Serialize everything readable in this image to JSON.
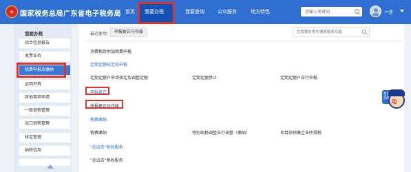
{
  "header": {
    "site_title": "国家税务总局广东省电子税务局",
    "nav": [
      "首页",
      "我要办税",
      "我要查询",
      "公众服务",
      "地方特色"
    ],
    "search_placeholder": "请输入关键词",
    "username": "**是",
    "active_nav": "我要办税"
  },
  "sidebar": {
    "title": "我要办税",
    "items": [
      "综合信息报告",
      "发票业务",
      "税费申报及缴纳",
      "证明开具",
      "其他事项申请",
      "一般退税管理",
      "出口退税管理",
      "核定管理",
      "纳税信用"
    ],
    "active_item": "税费申报及缴纳"
  },
  "main": {
    "recent_label": "最近使用：",
    "recent_chip": "申报更正与作废",
    "search_placeholder": "在我要办税中搜索服务功能",
    "row1": "消费税及附加税费申报",
    "section_periodic": "定期定额核定及申报",
    "periodic_items": [
      "定期定额户申请核定及调整定额",
      "定期定额停止",
      "定期定额户自行申报"
    ],
    "section_correction": "申报更正",
    "correction_item": "申报更正与作废",
    "section_tax_payment": "税费缴纳",
    "payment_items": [
      "税费缴纳",
      "特别纳税调整自行调整（缴纳）",
      "项目部预缴企业所得税"
    ],
    "section_outbound": "\"走出去\"税收服务",
    "outbound_item": "\"走出去\"税收服务"
  },
  "mascot": {
    "bubble_text": "在线办税",
    "word": "动"
  },
  "colors": {
    "header_blue": "#2f6fd1",
    "active_nav": "#1452b5",
    "highlight_red": "#e0312a",
    "link_blue": "#2f6fd1"
  }
}
